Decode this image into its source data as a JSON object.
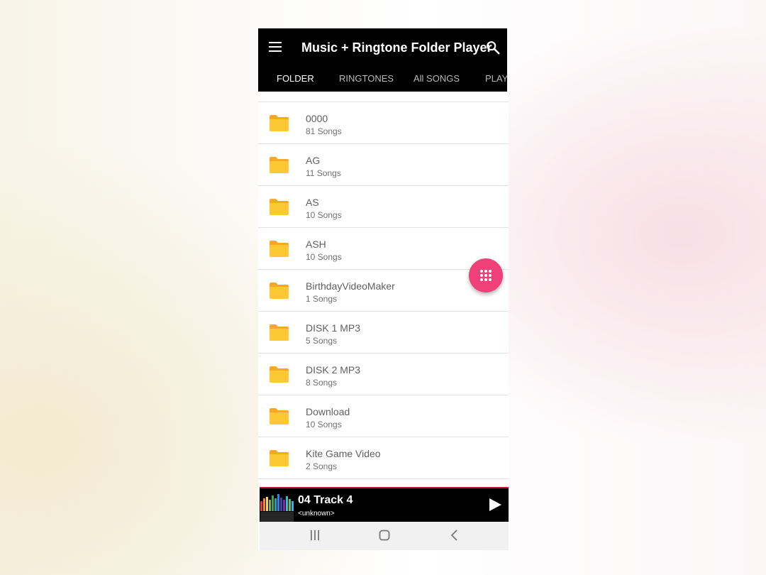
{
  "appbar": {
    "title": "Music + Ringtone Folder Player",
    "tabs": [
      {
        "label": "FOLDER",
        "active": true
      },
      {
        "label": "RINGTONES",
        "active": false
      },
      {
        "label": "All SONGS",
        "active": false
      },
      {
        "label": "PLAY",
        "active": false
      }
    ]
  },
  "folders": [
    {
      "name": "0000",
      "count": "81 Songs"
    },
    {
      "name": "AG",
      "count": "11 Songs"
    },
    {
      "name": "AS",
      "count": "10 Songs"
    },
    {
      "name": "ASH",
      "count": "10 Songs"
    },
    {
      "name": "BirthdayVideoMaker",
      "count": "1 Songs"
    },
    {
      "name": "DISK 1 MP3",
      "count": "5 Songs"
    },
    {
      "name": "DISK 2 MP3",
      "count": "8 Songs"
    },
    {
      "name": "Download",
      "count": "10 Songs"
    },
    {
      "name": "Kite Game Video",
      "count": "2 Songs"
    }
  ],
  "player": {
    "track_title": "04 Track 4",
    "track_artist": "<unknown>"
  },
  "colors": {
    "accent": "#f0407a",
    "folder": "#fbc02d",
    "appbar": "#000000"
  },
  "icons": [
    "menu-icon",
    "search-icon",
    "folder-icon",
    "grid-dots-icon",
    "equalizer-icon",
    "play-icon",
    "recent-apps-icon",
    "home-icon",
    "back-icon"
  ]
}
